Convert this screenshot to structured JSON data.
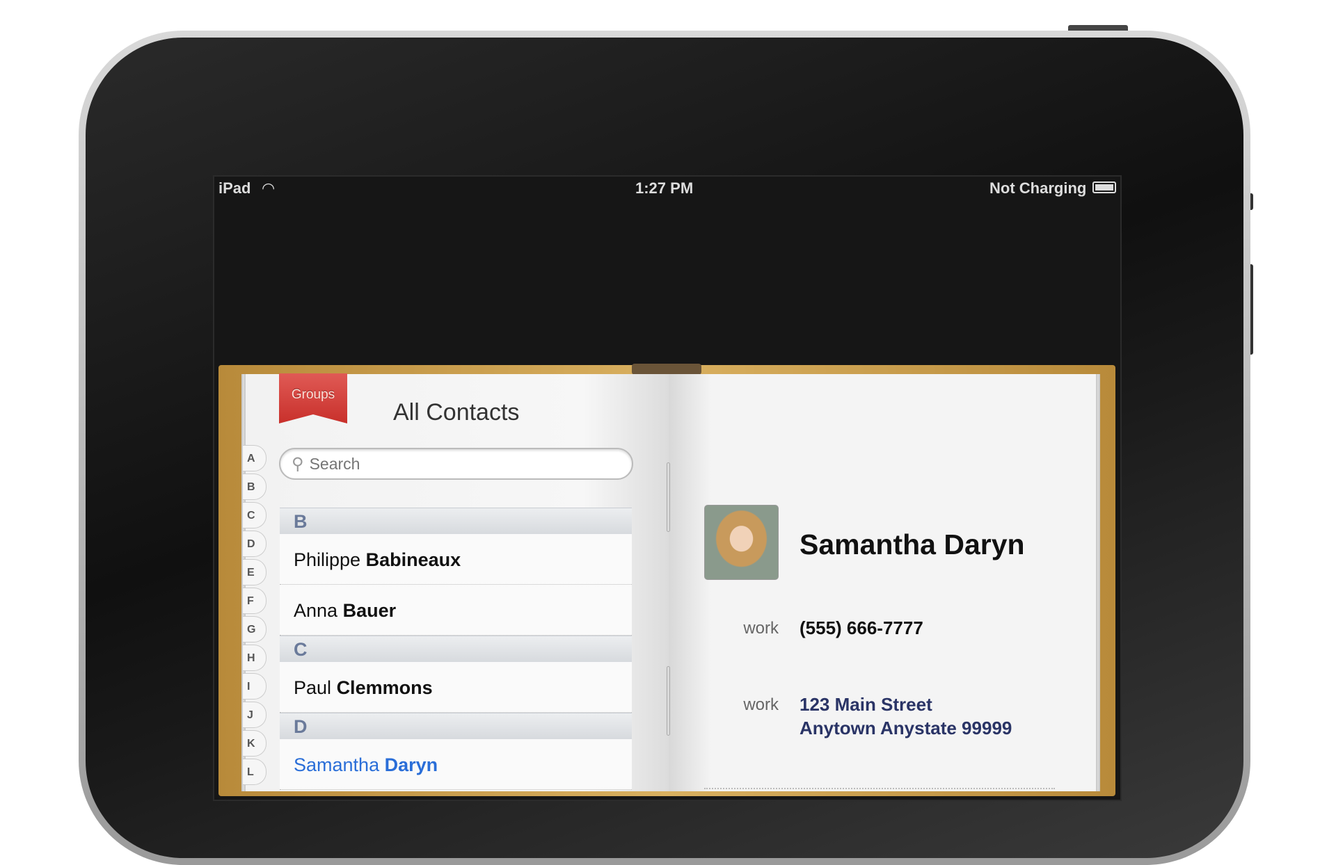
{
  "status_bar": {
    "device": "iPad",
    "time": "1:27 PM",
    "battery_status": "Not Charging"
  },
  "header": {
    "groups_label": "Groups",
    "title": "All Contacts"
  },
  "search": {
    "placeholder": "Search"
  },
  "index": [
    "A",
    "B",
    "C",
    "D",
    "E",
    "F",
    "G",
    "H",
    "I",
    "J",
    "K",
    "L"
  ],
  "list": [
    {
      "type": "section",
      "label": "B"
    },
    {
      "type": "row",
      "first": "Philippe",
      "last": "Babineaux"
    },
    {
      "type": "row",
      "first": "Anna",
      "last": "Bauer"
    },
    {
      "type": "section",
      "label": "C"
    },
    {
      "type": "row",
      "first": "Paul",
      "last": "Clemmons"
    },
    {
      "type": "section",
      "label": "D"
    },
    {
      "type": "row",
      "first": "Samantha",
      "last": "Daryn",
      "selected": true
    }
  ],
  "detail": {
    "name": "Samantha Daryn",
    "phone_label": "work",
    "phone": "(555) 666-7777",
    "address_label": "work",
    "address_line1": "123 Main Street",
    "address_line2": "Anytown Anystate 99999"
  },
  "colors": {
    "selected": "#2a6ed8",
    "address": "#2a3466",
    "ribbon": "#d0403a"
  }
}
